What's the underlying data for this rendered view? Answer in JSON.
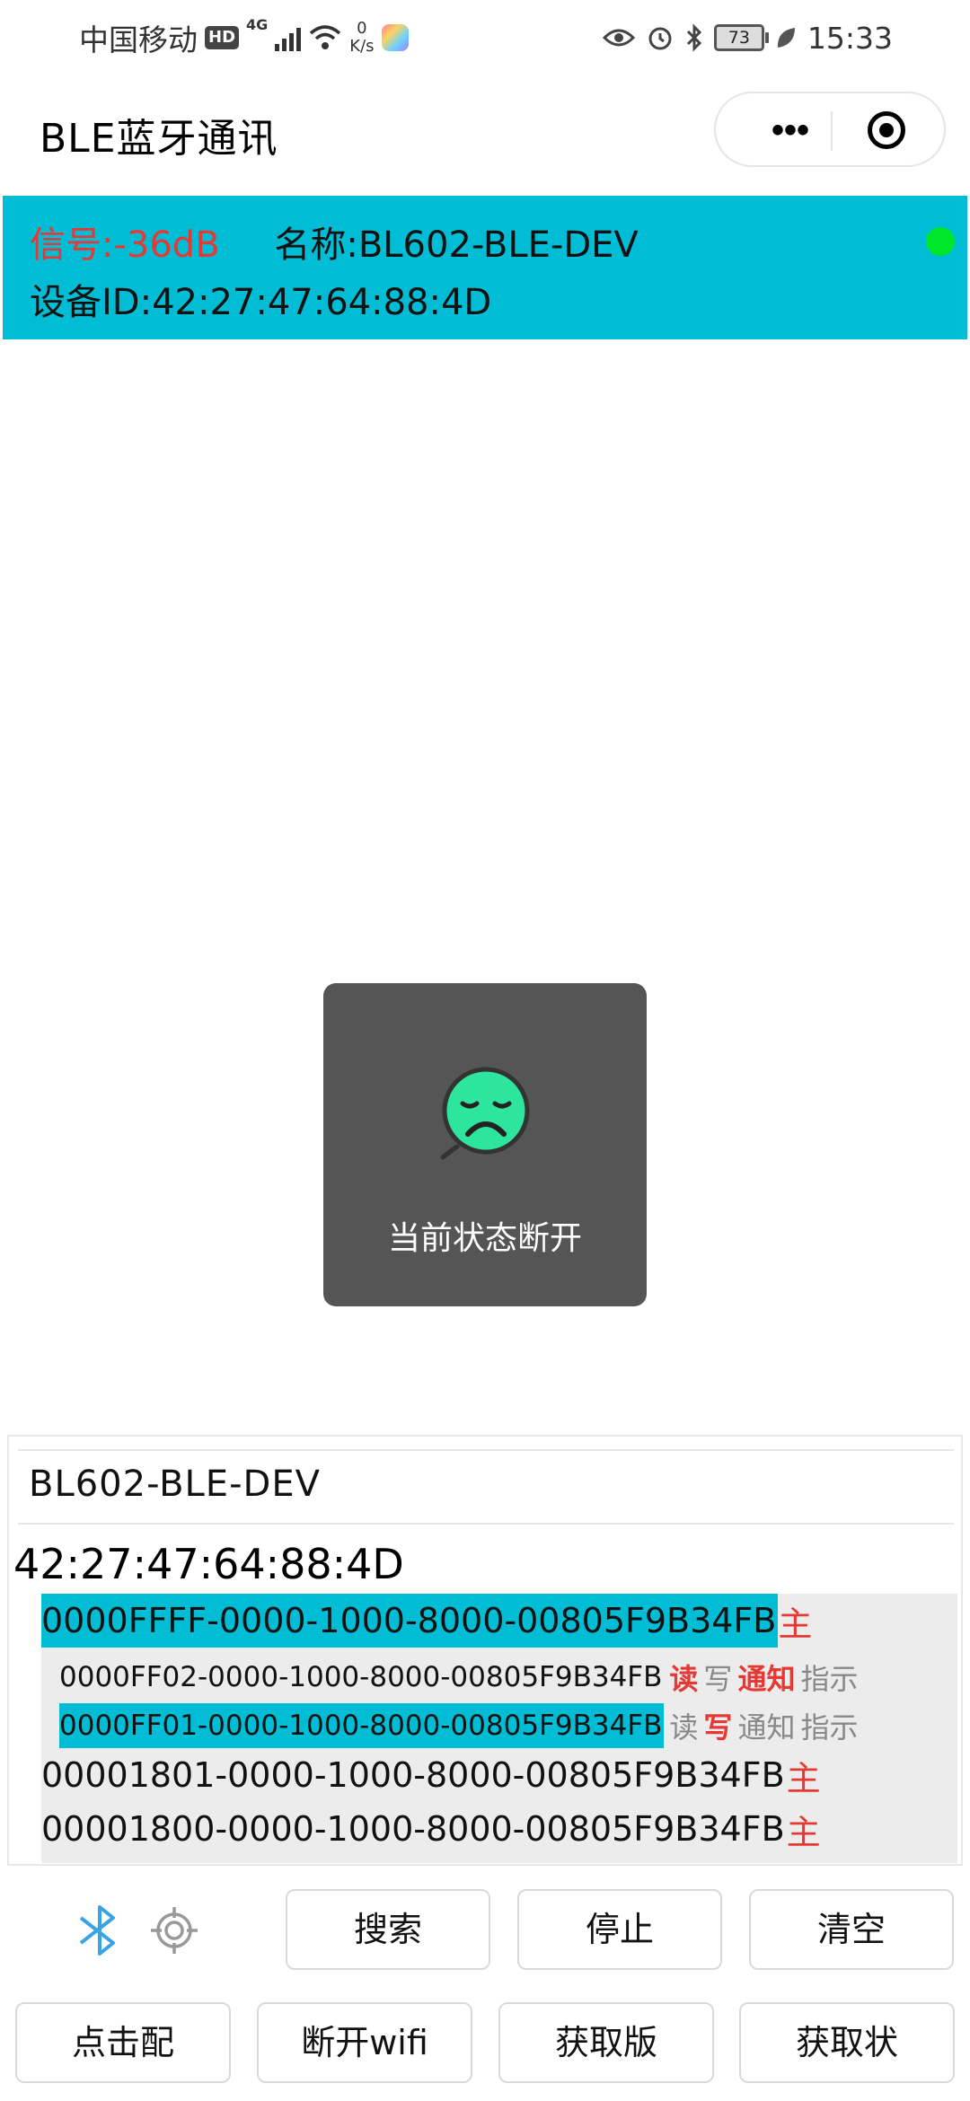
{
  "status_bar": {
    "carrier": "中国移动",
    "hd": "HD",
    "network": "4G",
    "speed_value": "0",
    "speed_unit": "K/s",
    "battery": "73",
    "time": "15:33"
  },
  "navbar": {
    "title": "BLE蓝牙通讯",
    "more_glyph": "•••"
  },
  "device_header": {
    "signal": "信号:-36dB",
    "name": "名称:BL602-BLE-DEV",
    "device_id": "设备ID:42:27:47:64:88:4D",
    "status_dot_color": "#00e62a"
  },
  "toast": {
    "icon": "sad-face-icon",
    "text": "当前状态断开"
  },
  "device_panel": {
    "name": "BL602-BLE-DEV",
    "address": "42:27:47:64:88:4D",
    "services": [
      {
        "uuid": "0000FFFF-0000-1000-8000-00805F9B34FB",
        "tag": "主"
      },
      {
        "uuid": "00001801-0000-1000-8000-00805F9B34FB",
        "tag": "主"
      },
      {
        "uuid": "00001800-0000-1000-8000-00805F9B34FB",
        "tag": "主"
      }
    ],
    "characteristics": [
      {
        "uuid": "0000FF02-0000-1000-8000-00805F9B34FB",
        "props": [
          "读",
          "写",
          "通知",
          "指示"
        ],
        "active": [
          true,
          false,
          true,
          false
        ]
      },
      {
        "uuid": "0000FF01-0000-1000-8000-00805F9B34FB",
        "props": [
          "读",
          "写",
          "通知",
          "指示"
        ],
        "active": [
          false,
          true,
          false,
          false
        ]
      }
    ]
  },
  "buttons": {
    "search": "搜索",
    "stop": "停止",
    "clear": "清空",
    "pair": "点击配",
    "disconnect_wifi": "断开wifi",
    "get_version": "获取版",
    "get_status": "获取状"
  },
  "colors": {
    "accent": "#00bcd4",
    "alert": "#e53935",
    "toast_bg": "#555555",
    "face": "#2ee59d"
  }
}
